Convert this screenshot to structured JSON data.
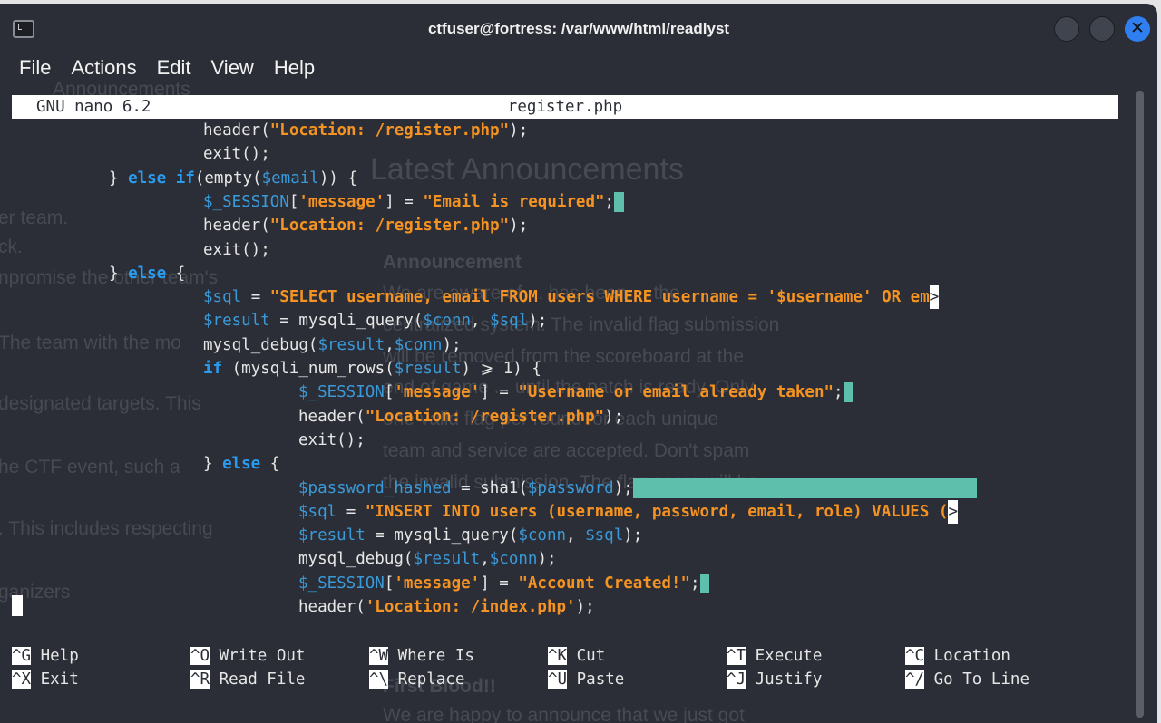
{
  "window": {
    "title": "ctfuser@fortress: /var/www/html/readlyst",
    "close_glyph": "✕",
    "icon": "terminal-icon"
  },
  "menu": [
    "File",
    "Actions",
    "Edit",
    "View",
    "Help"
  ],
  "nano": {
    "version": "GNU nano 6.2",
    "filename": "register.php"
  },
  "colors": {
    "background": "#2b2e36",
    "string": "#f59322",
    "variable": "#3a9ad9",
    "keyword": "#2a9cf0",
    "trailing_whitespace": "#5ebfac",
    "close_button": "#2f7ff0"
  },
  "code_lines": [
    [
      [
        "p",
        "header("
      ],
      [
        "s",
        "\"Location: /register.php\""
      ],
      [
        "p",
        ");"
      ]
    ],
    [
      [
        "p",
        "exit();"
      ]
    ],
    [
      [
        "p",
        "} "
      ],
      [
        "k",
        "else if"
      ],
      [
        "p",
        "(empty("
      ],
      [
        "v",
        "$email"
      ],
      [
        "p",
        ")) {"
      ]
    ],
    [
      [
        "v",
        "$_SESSION"
      ],
      [
        "p",
        "["
      ],
      [
        "s",
        "'message'"
      ],
      [
        "p",
        "] = "
      ],
      [
        "s",
        "\"Email is required\""
      ],
      [
        "p",
        ";"
      ],
      [
        "ws",
        " "
      ]
    ],
    [
      [
        "p",
        "header("
      ],
      [
        "s",
        "\"Location: /register.php\""
      ],
      [
        "p",
        ");"
      ]
    ],
    [
      [
        "p",
        "exit();"
      ]
    ],
    [
      [
        "p",
        "} "
      ],
      [
        "k",
        "else"
      ],
      [
        "p",
        " {"
      ]
    ],
    [
      [
        "v",
        "$sql"
      ],
      [
        "p",
        " = "
      ],
      [
        "s",
        "\"SELECT username, email FROM users WHERE username = '$username' OR em"
      ],
      [
        "m",
        ">"
      ]
    ],
    [
      [
        "v",
        "$result"
      ],
      [
        "p",
        " = mysqli_query("
      ],
      [
        "v",
        "$conn"
      ],
      [
        "p",
        ", "
      ],
      [
        "v",
        "$sql"
      ],
      [
        "p",
        ");"
      ]
    ],
    [
      [
        "p",
        "mysql_debug("
      ],
      [
        "v",
        "$result"
      ],
      [
        "p",
        ","
      ],
      [
        "v",
        "$conn"
      ],
      [
        "p",
        ");"
      ]
    ],
    [
      [
        "k",
        "if"
      ],
      [
        "p",
        " (mysqli_num_rows("
      ],
      [
        "v",
        "$result"
      ],
      [
        "p",
        ") ⩾ 1) {"
      ]
    ],
    [
      [
        "v",
        "$_SESSION"
      ],
      [
        "p",
        "["
      ],
      [
        "s",
        "'message'"
      ],
      [
        "p",
        "] = "
      ],
      [
        "s",
        "\"Username or email already taken\""
      ],
      [
        "p",
        ";"
      ],
      [
        "ws",
        " "
      ]
    ],
    [
      [
        "p",
        "header("
      ],
      [
        "s",
        "\"Location: /register.php\""
      ],
      [
        "p",
        ");"
      ]
    ],
    [
      [
        "p",
        "exit();"
      ]
    ],
    [
      [
        "p",
        "} "
      ],
      [
        "k",
        "else"
      ],
      [
        "p",
        " {"
      ]
    ],
    [
      [
        "v",
        "$password_hashed"
      ],
      [
        "p",
        " = sha1("
      ],
      [
        "v",
        "$password"
      ],
      [
        "p",
        ");"
      ],
      [
        "ws",
        "                                    "
      ]
    ],
    [
      [
        "v",
        "$sql"
      ],
      [
        "p",
        " = "
      ],
      [
        "s",
        "\"INSERT INTO users (username, password, email, role) VALUES ("
      ],
      [
        "m",
        ">"
      ]
    ],
    [
      [
        "v",
        "$result"
      ],
      [
        "p",
        " = mysqli_query("
      ],
      [
        "v",
        "$conn"
      ],
      [
        "p",
        ", "
      ],
      [
        "v",
        "$sql"
      ],
      [
        "p",
        ");"
      ]
    ],
    [
      [
        "p",
        "mysql_debug("
      ],
      [
        "v",
        "$result"
      ],
      [
        "p",
        ","
      ],
      [
        "v",
        "$conn"
      ],
      [
        "p",
        ");"
      ]
    ],
    [
      [
        "v",
        "$_SESSION"
      ],
      [
        "p",
        "["
      ],
      [
        "s",
        "'message'"
      ],
      [
        "p",
        "] = "
      ],
      [
        "s",
        "\"Account Created!\""
      ],
      [
        "p",
        ";"
      ],
      [
        "ws",
        " "
      ]
    ],
    [
      [
        "p",
        "header("
      ],
      [
        "s",
        "'Location: /index.php'"
      ],
      [
        "p",
        ");"
      ]
    ]
  ],
  "shortcuts": [
    {
      "key": "^G",
      "label": "Help"
    },
    {
      "key": "^X",
      "label": "Exit"
    },
    {
      "key": "^O",
      "label": "Write Out"
    },
    {
      "key": "^R",
      "label": "Read File"
    },
    {
      "key": "^W",
      "label": "Where Is"
    },
    {
      "key": "^\\",
      "label": "Replace"
    },
    {
      "key": "^K",
      "label": "Cut"
    },
    {
      "key": "^U",
      "label": "Paste"
    },
    {
      "key": "^T",
      "label": "Execute"
    },
    {
      "key": "^J",
      "label": "Justify"
    },
    {
      "key": "^C",
      "label": "Location"
    },
    {
      "key": "^/",
      "label": "Go To Line"
    }
  ],
  "background_page": {
    "nav": "Announcements",
    "heading": "Latest Announcements",
    "announcement_title": "Announcement",
    "announcement_lines": [
      "We are aware of ... has been ... the",
      "centralized system. The invalid flag submission",
      "will be removed from the scoreboard at the",
      "end of game ... until the patch is ready. Only",
      "one valid flag per round for each unique",
      "team and service are accepted. Don't spam",
      "the invalid submission. The flag score will be"
    ],
    "left_fragments": [
      "er team.",
      "ck.",
      "npromise the other team's",
      "The team with the mo",
      "designated targets. This",
      "he CTF event, such a",
      ". This includes respecting",
      "ganizers"
    ],
    "second_title": "First Blood!!",
    "second_text": "We are happy to announce that we just got"
  }
}
